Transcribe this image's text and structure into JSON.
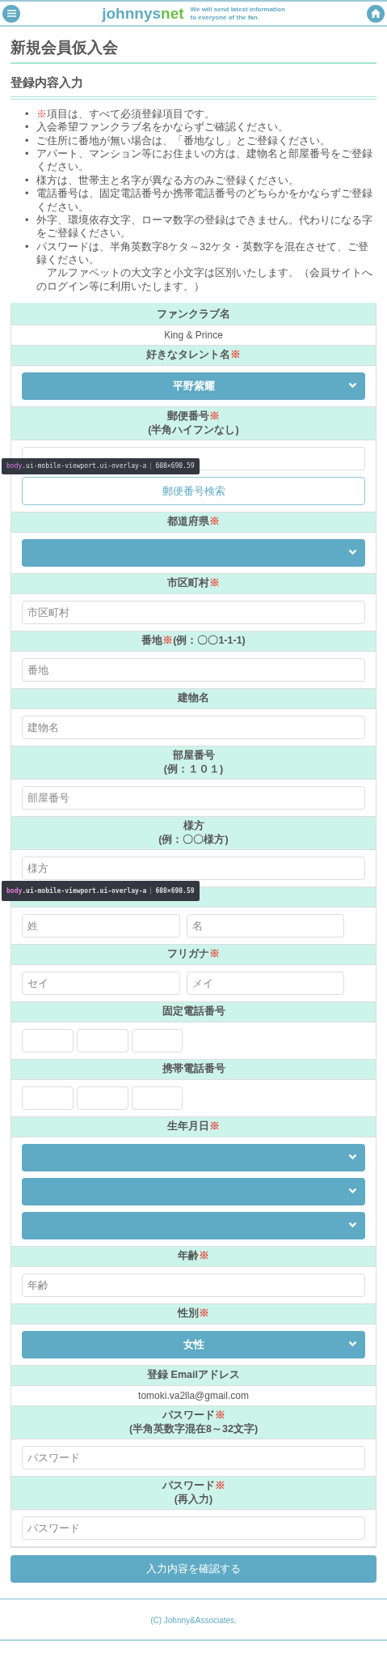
{
  "header": {
    "logo_main": "johnnys",
    "logo_accent": "net",
    "tagline": [
      "We will send latest information",
      "to everyone of the fan."
    ]
  },
  "page_title": "新規会員仮入会",
  "section_title": "登録内容入力",
  "notes": [
    {
      "bullet": "•",
      "mark": "※",
      "lines": [
        "項目は、すべて必須登録項目です。"
      ]
    },
    {
      "bullet": "•",
      "lines": [
        "入会希望ファンクラブ名をかならずご確認ください。"
      ]
    },
    {
      "bullet": "•",
      "lines": [
        "ご住所に番地が無い場合は、「番地なし」とご登録ください。"
      ]
    },
    {
      "bullet": "•",
      "lines": [
        "アパート、マンション等にお住まいの方は、建物名と部屋番号をご登録ください。"
      ]
    },
    {
      "bullet": "•",
      "lines": [
        "様方は、世帯主と名字が異なる方のみご登録ください。"
      ]
    },
    {
      "bullet": "•",
      "lines": [
        "電話番号は、固定電話番号か携帯電話番号のどちらかをかならずご登録ください。"
      ]
    },
    {
      "bullet": "•",
      "lines": [
        "外字、環境依存文字、ローマ数字の登録はできません。代わりになる字をご登録ください。"
      ]
    },
    {
      "bullet": "•",
      "lines": [
        "パスワードは、半角英数字8ケタ～32ケタ・英数字を混在させて、ご登録ください。",
        "　アルファベットの大文字と小文字は区別いたします。（会員サイトへのログイン等に利用いたします。）"
      ]
    }
  ],
  "fields": [
    {
      "label": "ファンクラブ名",
      "controls": [
        {
          "kind": "text",
          "value": "King & Prince"
        }
      ]
    },
    {
      "label": "好きなタレント名",
      "mark": "※",
      "controls": [
        {
          "kind": "select",
          "value": "平野紫耀"
        }
      ]
    },
    {
      "label": "郵便番号",
      "mark": "※",
      "note": "(半角ハイフンなし)",
      "controls": [
        {
          "kind": "input"
        },
        {
          "kind": "button",
          "label": "郵便番号検索"
        }
      ],
      "tooltip": {
        "tag": "body",
        "classes": ".ui-mobile-viewport.ui-overlay-a",
        "size": "608×690.59"
      }
    },
    {
      "label": "都道府県",
      "mark": "※",
      "controls": [
        {
          "kind": "select"
        }
      ]
    },
    {
      "label": "市区町村",
      "mark": "※",
      "controls": [
        {
          "kind": "input",
          "placeholder": "市区町村"
        }
      ]
    },
    {
      "label": "番地",
      "mark": "※",
      "inline_note": "(例：〇〇1-1-1)",
      "controls": [
        {
          "kind": "input",
          "placeholder": "番地"
        }
      ]
    },
    {
      "label": "建物名",
      "controls": [
        {
          "kind": "input",
          "placeholder": "建物名"
        }
      ]
    },
    {
      "label": "部屋番号",
      "note": "(例：１０１)",
      "controls": [
        {
          "kind": "input",
          "placeholder": "部屋番号"
        }
      ]
    },
    {
      "label": "様方",
      "note": "(例：〇〇様方)",
      "controls": [
        {
          "kind": "input",
          "placeholder": "様方"
        }
      ]
    },
    {
      "controls": [
        {
          "kind": "half",
          "placeholder": "姓"
        },
        {
          "kind": "half",
          "placeholder": "名"
        }
      ],
      "tooltip": {
        "tag": "body",
        "classes": ".ui-mobile-viewport.ui-overlay-a",
        "size": "608×690.59"
      }
    },
    {
      "label": "フリガナ",
      "mark": "※",
      "controls": [
        {
          "kind": "half",
          "placeholder": "セイ"
        },
        {
          "kind": "half",
          "placeholder": "メイ"
        }
      ]
    },
    {
      "label": "固定電話番号",
      "controls": [
        {
          "kind": "short"
        },
        {
          "kind": "short"
        },
        {
          "kind": "short"
        }
      ]
    },
    {
      "label": "携帯電話番号",
      "controls": [
        {
          "kind": "short"
        },
        {
          "kind": "short"
        },
        {
          "kind": "short"
        }
      ]
    },
    {
      "label": "生年月日",
      "mark": "※",
      "controls": [
        {
          "kind": "select"
        },
        {
          "kind": "select"
        },
        {
          "kind": "select"
        }
      ]
    },
    {
      "label": "年齢",
      "mark": "※",
      "controls": [
        {
          "kind": "input",
          "placeholder": "年齢"
        }
      ]
    },
    {
      "label": "性別",
      "mark": "※",
      "controls": [
        {
          "kind": "select",
          "value": "女性"
        }
      ]
    },
    {
      "label": "登録 Emailアドレス",
      "controls": [
        {
          "kind": "text",
          "value": "tomoki.va2lla@gmail.com"
        }
      ]
    },
    {
      "label": "パスワード",
      "mark": "※",
      "note": "(半角英数字混在8～32文字)",
      "controls": [
        {
          "kind": "input",
          "placeholder": "パスワード"
        }
      ]
    },
    {
      "label": "パスワード",
      "mark": "※",
      "note": "(再入力)",
      "controls": [
        {
          "kind": "input",
          "placeholder": "パスワード"
        }
      ]
    }
  ],
  "submit": "入力内容を確認する",
  "footer": "(C) Johnny&Associates."
}
